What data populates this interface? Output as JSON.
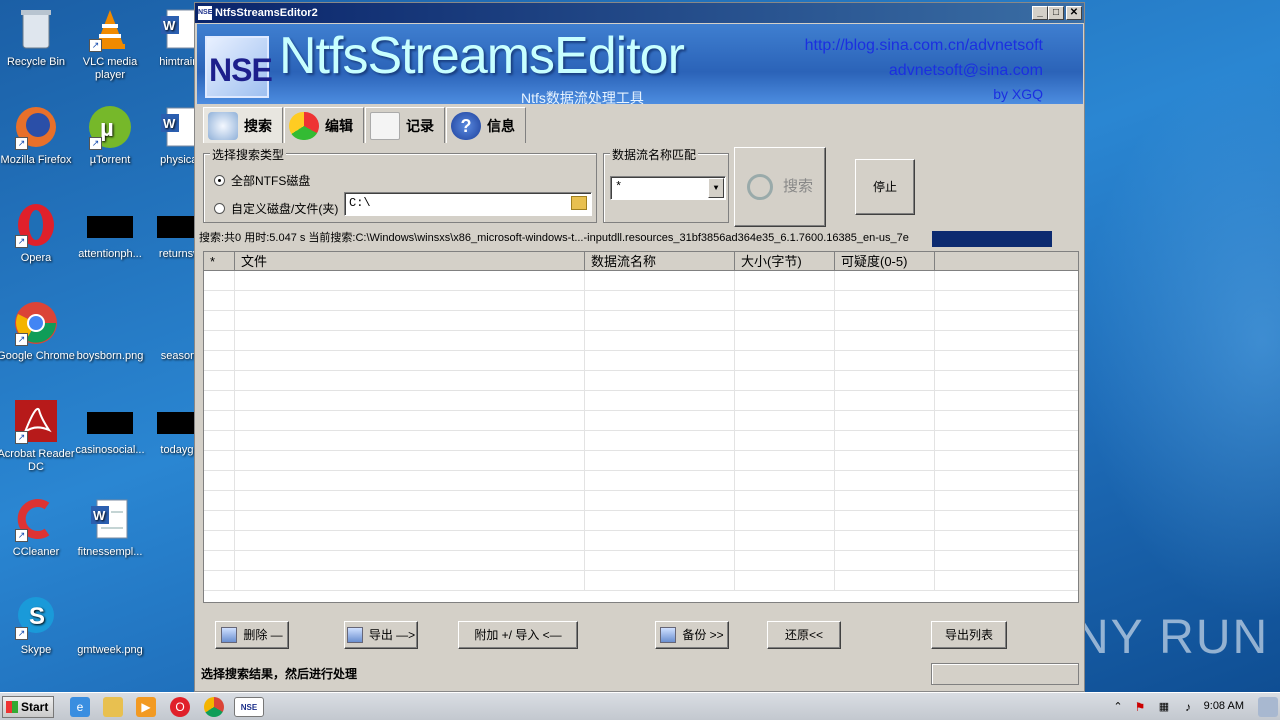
{
  "desktop": {
    "icons": [
      {
        "label": "Recycle Bin",
        "icon": "recycle-bin-icon"
      },
      {
        "label": "VLC media player",
        "icon": "vlc-icon"
      },
      {
        "label": "himtraini",
        "icon": "word-doc-icon"
      },
      {
        "label": "Mozilla Firefox",
        "icon": "firefox-icon"
      },
      {
        "label": "µTorrent",
        "icon": "utorrent-icon"
      },
      {
        "label": "physical",
        "icon": "word-doc-icon"
      },
      {
        "label": "Opera",
        "icon": "opera-icon"
      },
      {
        "label": "attentionph...",
        "icon": "redacted-thumbnail"
      },
      {
        "label": "returnsw",
        "icon": "redacted-thumbnail"
      },
      {
        "label": "Google Chrome",
        "icon": "chrome-icon"
      },
      {
        "label": "boysborn.png",
        "icon": "image-thumbnail"
      },
      {
        "label": "seasonf",
        "icon": "image-thumbnail"
      },
      {
        "label": "Acrobat Reader DC",
        "icon": "acrobat-icon"
      },
      {
        "label": "casinosocial...",
        "icon": "redacted-thumbnail"
      },
      {
        "label": "todaygo",
        "icon": "redacted-thumbnail"
      },
      {
        "label": "CCleaner",
        "icon": "ccleaner-icon"
      },
      {
        "label": "fitnessempl...",
        "icon": "word-doc-icon"
      },
      {
        "label": "Skype",
        "icon": "skype-icon"
      },
      {
        "label": "gmtweek.png",
        "icon": "image-thumbnail"
      }
    ],
    "watermark": "ANY RUN"
  },
  "taskbar": {
    "start_label": "Start",
    "clock": "9:08 AM",
    "pinned": [
      "internet-explorer-icon",
      "explorer-folder-icon",
      "media-player-icon",
      "opera-icon",
      "chrome-icon",
      "nse-icon"
    ]
  },
  "window": {
    "title": "NtfsStreamsEditor2",
    "banner": {
      "logo_text": "NSE",
      "app_name": "NtfsStreamsEditor",
      "subtitle": "Ntfs数据流处理工具",
      "url": "http://blog.sina.com.cn/advnetsoft",
      "email": "advnetsoft@sina.com",
      "author": "by XGQ"
    },
    "tabs": [
      "搜索",
      "编辑",
      "记录",
      "信息"
    ],
    "search_type": {
      "group_label": "选择搜索类型",
      "option_all": "全部NTFS磁盘",
      "option_custom": "自定义磁盘/文件(夹)",
      "path_value": "C:\\"
    },
    "name_match": {
      "group_label": "数据流名称匹配",
      "value": "*"
    },
    "search_button": "搜索",
    "stop_button": "停止",
    "status_line": "搜索:共0   用时:5.047 s   当前搜索:C:\\Windows\\winsxs\\x86_microsoft-windows-t...-inputdll.resources_31bf3856ad364e35_6.1.7600.16385_en-us_7e",
    "columns": [
      "*",
      "文件",
      "数据流名称",
      "大小(字节)",
      "可疑度(0-5)",
      ""
    ],
    "bottom_buttons": {
      "delete": "删除 —",
      "export": "导出 —>",
      "append_import": "附加 +/ 导入 <—",
      "backup": "备份 >>",
      "restore": "还原<<",
      "export_list": "导出列表"
    },
    "hint": "选择搜索结果，然后进行处理"
  },
  "colors": {
    "titlebar": "#0a246a",
    "banner": "#2b63b8",
    "progress": "#0c2a70",
    "desktop": "#1f6fb6"
  }
}
